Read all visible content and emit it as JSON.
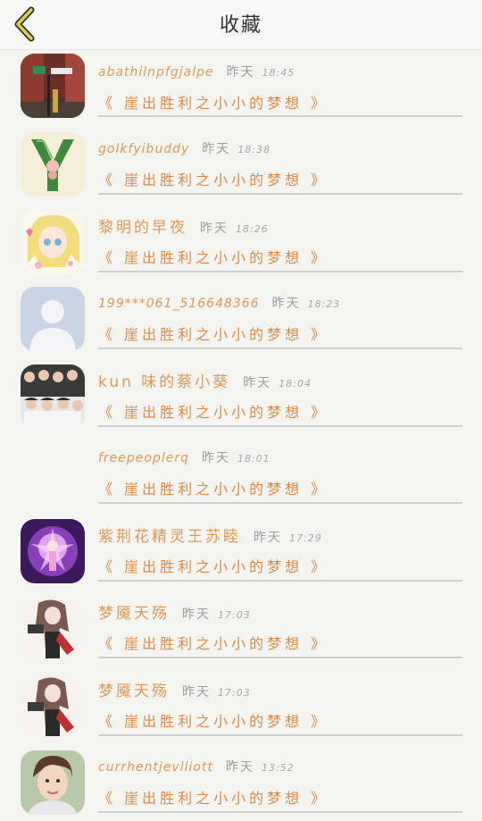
{
  "header": {
    "title": "收藏",
    "back_icon": "chevron-left-icon"
  },
  "items": [
    {
      "name": "abathilnpfgjalpe",
      "day": "昨天",
      "time": "18:45",
      "quote": "《 崖出胜利之小小的梦想 》",
      "avatar": "street-photo"
    },
    {
      "name": "golkfyibuddy",
      "day": "昨天",
      "time": "18:38",
      "quote": "《 崖出胜利之小小的梦想 》",
      "avatar": "green-letter-y"
    },
    {
      "name": "黎明的早夜",
      "day": "昨天",
      "time": "18:26",
      "quote": "《 崖出胜利之小小的梦想 》",
      "avatar": "anime-blonde-girl"
    },
    {
      "name": "199***061_516648366",
      "day": "昨天",
      "time": "18:23",
      "quote": "《 崖出胜利之小小的梦想 》",
      "avatar": "default-person"
    },
    {
      "name": "kun 味的蔡小葵",
      "day": "昨天",
      "time": "18:04",
      "quote": "《 崖出胜利之小小的梦想 》",
      "avatar": "group-photo"
    },
    {
      "name": "freepeoplerq",
      "day": "昨天",
      "time": "18:01",
      "quote": "《 崖出胜利之小小的梦想 》",
      "avatar": "none"
    },
    {
      "name": "紫荆花精灵王苏睦",
      "day": "昨天",
      "time": "17:29",
      "quote": "《 崖出胜利之小小的梦想 》",
      "avatar": "purple-fairy"
    },
    {
      "name": "梦魇天殇",
      "day": "昨天",
      "time": "17:03",
      "quote": "《 崖出胜利之小小的梦想 》",
      "avatar": "anime-warrior"
    },
    {
      "name": "梦魇天殇",
      "day": "昨天",
      "time": "17:03",
      "quote": "《 崖出胜利之小小的梦想 》",
      "avatar": "anime-warrior"
    },
    {
      "name": "currhentjevlliott",
      "day": "昨天",
      "time": "13:52",
      "quote": "《 崖出胜利之小小的梦想 》",
      "avatar": "boy-portrait"
    }
  ]
}
